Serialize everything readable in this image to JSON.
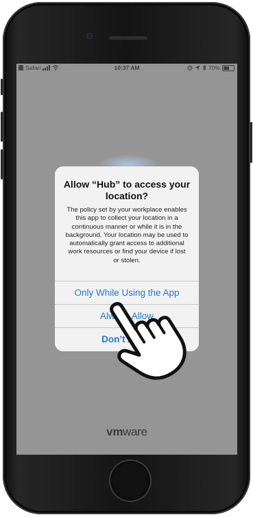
{
  "status_bar": {
    "back_app": "Safari",
    "time": "10:37 AM",
    "battery": "70%",
    "battery_level": 0.7
  },
  "alert": {
    "title": "Allow “Hub” to access your location?",
    "message": "The policy set by your workplace enables this app to collect your location in a continuous manner or while it is in the background. Your location may be used to automatically grant access to additional work resources or find your device if lost or stolen.",
    "buttons": {
      "only_while_using": "Only While Using the App",
      "always_allow": "Always Allow",
      "dont_allow": "Don’t Allow"
    }
  },
  "brand": {
    "vm": "vm",
    "ware": "ware"
  },
  "colors": {
    "accent": "#1f7ae0",
    "screen_dim": "#959595",
    "alert_bg": "#f2f2f2"
  },
  "icons": [
    "signal-icon",
    "wifi-icon",
    "location-icon",
    "alarm-icon",
    "battery-icon",
    "pointing-hand-icon"
  ]
}
